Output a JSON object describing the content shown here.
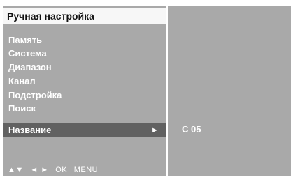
{
  "menu": {
    "title": "Ручная настройка",
    "items": [
      {
        "label": "Память"
      },
      {
        "label": "Система"
      },
      {
        "label": "Диапазон"
      },
      {
        "label": "Канал"
      },
      {
        "label": "Подстройка"
      },
      {
        "label": "Поиск"
      },
      {
        "label": "Название",
        "selected": true
      }
    ],
    "submenu_arrow": "►"
  },
  "value_panel": {
    "value": "C 05"
  },
  "hints": {
    "updown": "▲▼",
    "leftright": "◄ ►",
    "ok": "OK",
    "menu": "MENU"
  },
  "colors": {
    "panel": "#a9a9a9",
    "title_bar": "#f7f7f7",
    "selected_row": "#616161",
    "text": "#ffffff"
  }
}
